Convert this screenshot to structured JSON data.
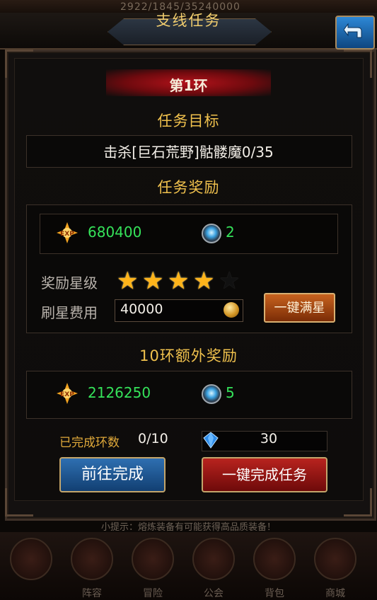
{
  "top_hint": "2922/1845/35240000",
  "header": {
    "title": "支线任务",
    "back_icon": "back-arrow-icon"
  },
  "ring": {
    "label": "第1环"
  },
  "objective": {
    "title": "任务目标",
    "text": "击杀[巨石荒野]骷髅魔0/35"
  },
  "reward": {
    "title": "任务奖励",
    "exp_icon_text": "EXP",
    "exp": "680400",
    "gem": "2",
    "star_label": "奖励星级",
    "stars_filled": 4,
    "stars_total": 5,
    "cost_label": "刷星费用",
    "cost": "40000",
    "max_star_button": "一键满星"
  },
  "bonus": {
    "title": "10环额外奖励",
    "exp": "2126250",
    "gem": "5"
  },
  "progress": {
    "done_label": "已完成环数",
    "done_value": "0/10",
    "diamond_value": "30"
  },
  "buttons": {
    "go": "前往完成",
    "complete": "一键完成任务"
  },
  "tip": "小提示：熔炼装备有可能获得高品质装备！",
  "nav": [
    {
      "label": "",
      "icon": "shield-icon"
    },
    {
      "label": "阵容",
      "icon": "helmet-icon"
    },
    {
      "label": "冒险",
      "icon": "demon-icon"
    },
    {
      "label": "公会",
      "icon": "guild-icon"
    },
    {
      "label": "背包",
      "icon": "backpack-icon"
    },
    {
      "label": "商城",
      "icon": "chest-icon"
    }
  ],
  "colors": {
    "gold": "#f0c14d",
    "green": "#35e35a",
    "red_banner": "#b3121a",
    "blue_button": "#2e6fb1"
  }
}
